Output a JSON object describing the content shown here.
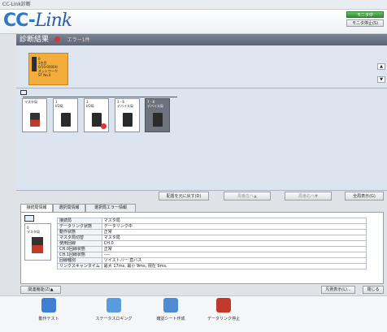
{
  "window": {
    "title": "CC-Link診断"
  },
  "header": {
    "logo_prefix": "CC-",
    "logo_suffix": "Link",
    "monitor_button": "モニタ中",
    "monitor_stop_button": "モニタ停止(S)"
  },
  "status_bar": {
    "title": "診断結果",
    "error_text": "エラー1件"
  },
  "master": {
    "lines": [
      "0",
      "1台目",
      "0/10-0000H",
      "ネットワーク",
      "ST No.0"
    ]
  },
  "side_buttons": {
    "up": "▲",
    "down": "▼"
  },
  "stations": [
    {
      "label": "マスタ局",
      "style": "white",
      "module": "red",
      "error": false
    },
    {
      "label": "1\nI/O局",
      "style": "white",
      "module": "dark",
      "error": false
    },
    {
      "label": "3\nI/O局",
      "style": "white",
      "module": "dark",
      "error": true
    },
    {
      "label": "3 - 6\nデバイス局",
      "style": "white",
      "module": "dark",
      "error": false
    },
    {
      "label": "7 - 8\nデバイス局",
      "style": "grey",
      "module": "dark",
      "error": false
    }
  ],
  "toolbar": {
    "restore": "配置を元に戻す(D)",
    "left": "局番左へ▲",
    "right": "局番右へ▼",
    "all": "全局表示(G)"
  },
  "tabs": [
    "接続局情報",
    "選択局情報",
    "選択局エラー情報"
  ],
  "detail_station": {
    "label": "0\nマスタ局"
  },
  "properties": [
    {
      "key": "接続局",
      "value": "マスタ局"
    },
    {
      "key": "データリンク状態",
      "value": "データリンク中"
    },
    {
      "key": "動作状態",
      "value": "正常"
    },
    {
      "key": "マスタ局切替",
      "value": "マスタ局"
    },
    {
      "key": "使用回線",
      "value": "CH.0"
    },
    {
      "key": "CH.0回線状態",
      "value": "正常"
    },
    {
      "key": "CH.1回線状態",
      "value": "----"
    },
    {
      "key": "回線種別",
      "value": "ツイストバー:直バス"
    },
    {
      "key": "リンクスキャンタイム",
      "value": "最大 17ms, 最小 9ms, 現在 9ms,"
    }
  ],
  "section": {
    "related_button": "関連機能(Z)▲",
    "table_button": "凡例表示(L)...",
    "close_button": "閉じる"
  },
  "actions": [
    {
      "label": "動作テスト",
      "color": "#3f7fd1"
    },
    {
      "label": "ステータスロギング",
      "color": "#5a9be0"
    },
    {
      "label": "確認シート作成",
      "color": "#4e8bd3"
    },
    {
      "label": "データリンク停止",
      "color": "#c0392b"
    }
  ]
}
